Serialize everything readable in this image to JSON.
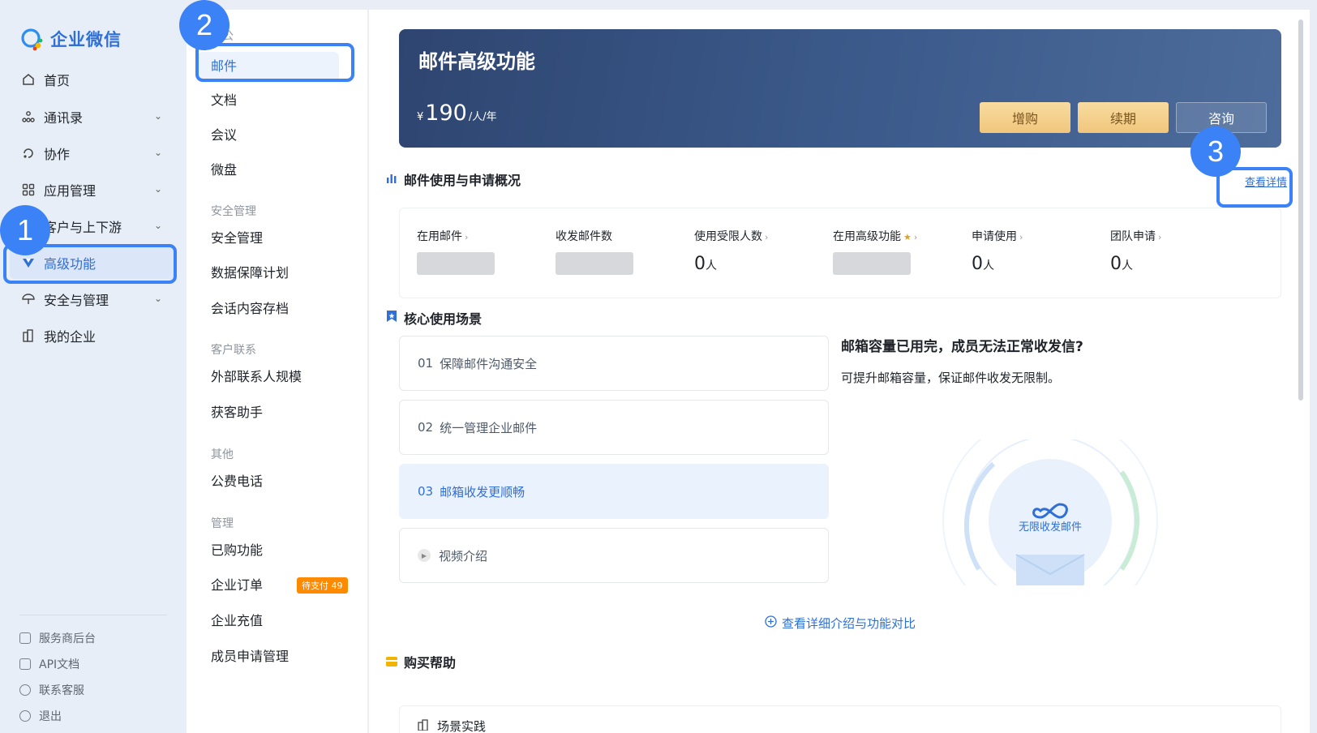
{
  "app": {
    "name": "企业微信"
  },
  "sidebar": {
    "items": [
      {
        "label": "首页",
        "icon": "home-icon"
      },
      {
        "label": "通讯录",
        "icon": "org-icon"
      },
      {
        "label": "协作",
        "icon": "collab-icon"
      },
      {
        "label": "应用管理",
        "icon": "apps-icon"
      },
      {
        "label": "客户与上下游",
        "icon": "customer-icon"
      },
      {
        "label": "高级功能",
        "icon": "vip-icon"
      },
      {
        "label": "安全与管理",
        "icon": "security-icon"
      },
      {
        "label": "我的企业",
        "icon": "company-icon"
      }
    ],
    "footer": [
      {
        "label": "服务商后台"
      },
      {
        "label": "API文档"
      },
      {
        "label": "联系客服"
      },
      {
        "label": "退出"
      }
    ]
  },
  "subnav": {
    "group_office": "办公",
    "mail": "邮件",
    "docs": "文档",
    "meeting": "会议",
    "drive": "微盘",
    "group_security": "安全管理",
    "security": "安全管理",
    "data_guard": "数据保障计划",
    "archive": "会话内容存档",
    "group_customer": "客户联系",
    "external_contacts": "外部联系人规模",
    "acquire": "获客助手",
    "group_other": "其他",
    "phone": "公费电话",
    "group_manage": "管理",
    "purchased": "已购功能",
    "orders": "企业订单",
    "orders_badge": "待支付 49",
    "recharge": "企业充值",
    "member_apply": "成员申请管理"
  },
  "hero": {
    "title": "邮件高级功能",
    "currency": "¥",
    "price": "190",
    "unit": "/人/年",
    "btn_add": "增购",
    "btn_renew": "续期",
    "btn_consult": "咨询"
  },
  "usage": {
    "title": "邮件使用与申请概况",
    "view_detail": "查看详情",
    "stats": [
      {
        "label": "在用邮件"
      },
      {
        "label": "收发邮件数"
      },
      {
        "label": "使用受限人数",
        "value": "0",
        "unit": "人"
      },
      {
        "label": "在用高级功能"
      },
      {
        "label": "申请使用",
        "value": "0",
        "unit": "人"
      },
      {
        "label": "团队申请",
        "value": "0",
        "unit": "人"
      }
    ]
  },
  "scenes": {
    "title": "核心使用场景",
    "items": [
      {
        "num": "01",
        "label": "保障邮件沟通安全"
      },
      {
        "num": "02",
        "label": "统一管理企业邮件"
      },
      {
        "num": "03",
        "label": "邮箱收发更顺畅"
      }
    ],
    "video": "视频介绍",
    "promo_title": "邮箱容量已用完，成员无法正常收发信?",
    "promo_desc": "可提升邮箱容量，保证邮件收发无限制。",
    "illustration_label": "无限收发邮件",
    "compare_link": "查看详细介绍与功能对比"
  },
  "help": {
    "title": "购买帮助",
    "item": "场景实践"
  },
  "markers": [
    "1",
    "2",
    "3"
  ],
  "colors": {
    "accent": "#2f6fd6",
    "highlight": "#3b82f6",
    "gold": "#f0c67c",
    "badge": "#ff8a00"
  }
}
